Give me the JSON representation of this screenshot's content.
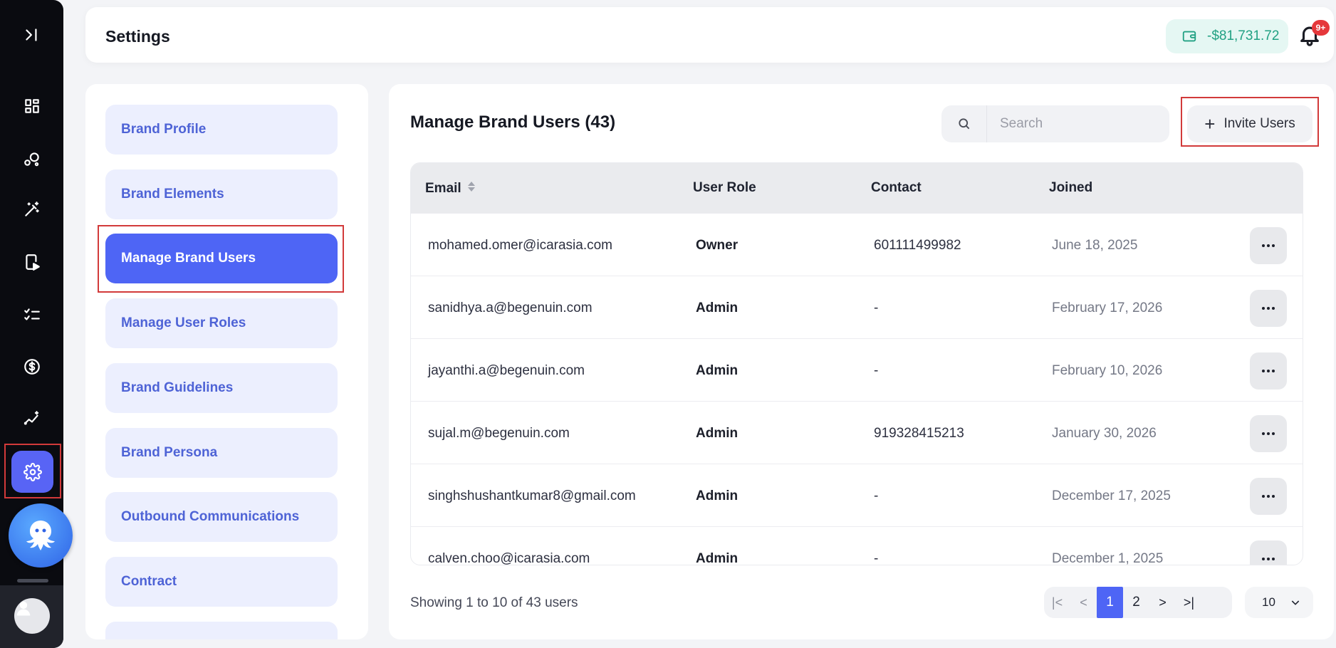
{
  "header": {
    "title": "Settings",
    "wallet_balance": "-$81,731.72",
    "notification_badge": "9+"
  },
  "rail": {
    "icons": [
      "collapse-icon",
      "dashboard-icon",
      "integrations-icon",
      "magic-wand-icon",
      "mobile-video-icon",
      "checklist-icon",
      "dollar-icon",
      "analytics-icon",
      "settings-icon"
    ],
    "active": "settings-icon"
  },
  "settings_nav": {
    "items": [
      {
        "label": "Brand Profile"
      },
      {
        "label": "Brand Elements"
      },
      {
        "label": "Manage Brand Users"
      },
      {
        "label": "Manage User Roles"
      },
      {
        "label": "Brand Guidelines"
      },
      {
        "label": "Brand Persona"
      },
      {
        "label": "Outbound Communications"
      },
      {
        "label": "Contract"
      }
    ],
    "active_index": 2
  },
  "main": {
    "title": "Manage Brand Users (43)",
    "search_placeholder": "Search",
    "invite_label": "Invite Users",
    "columns": [
      "Email",
      "User Role",
      "Contact",
      "Joined"
    ],
    "rows": [
      {
        "email": "mohamed.omer@icarasia.com",
        "role": "Owner",
        "contact": "601111499982",
        "joined": "June 18, 2025"
      },
      {
        "email": "sanidhya.a@begenuin.com",
        "role": "Admin",
        "contact": "-",
        "joined": "February 17, 2026"
      },
      {
        "email": "jayanthi.a@begenuin.com",
        "role": "Admin",
        "contact": "-",
        "joined": "February 10, 2026"
      },
      {
        "email": "sujal.m@begenuin.com",
        "role": "Admin",
        "contact": "919328415213",
        "joined": "January 30, 2026"
      },
      {
        "email": "singhshushantkumar8@gmail.com",
        "role": "Admin",
        "contact": "-",
        "joined": "December 17, 2025"
      },
      {
        "email": "calven.choo@icarasia.com",
        "role": "Admin",
        "contact": "-",
        "joined": "December 1, 2025"
      }
    ],
    "footer_text": "Showing 1 to 10 of 43 users",
    "pagination": {
      "first": "|<",
      "prev": "<",
      "pages": [
        "1",
        "2"
      ],
      "current": "1",
      "next": ">",
      "last": ">|"
    },
    "per_page": "10"
  }
}
